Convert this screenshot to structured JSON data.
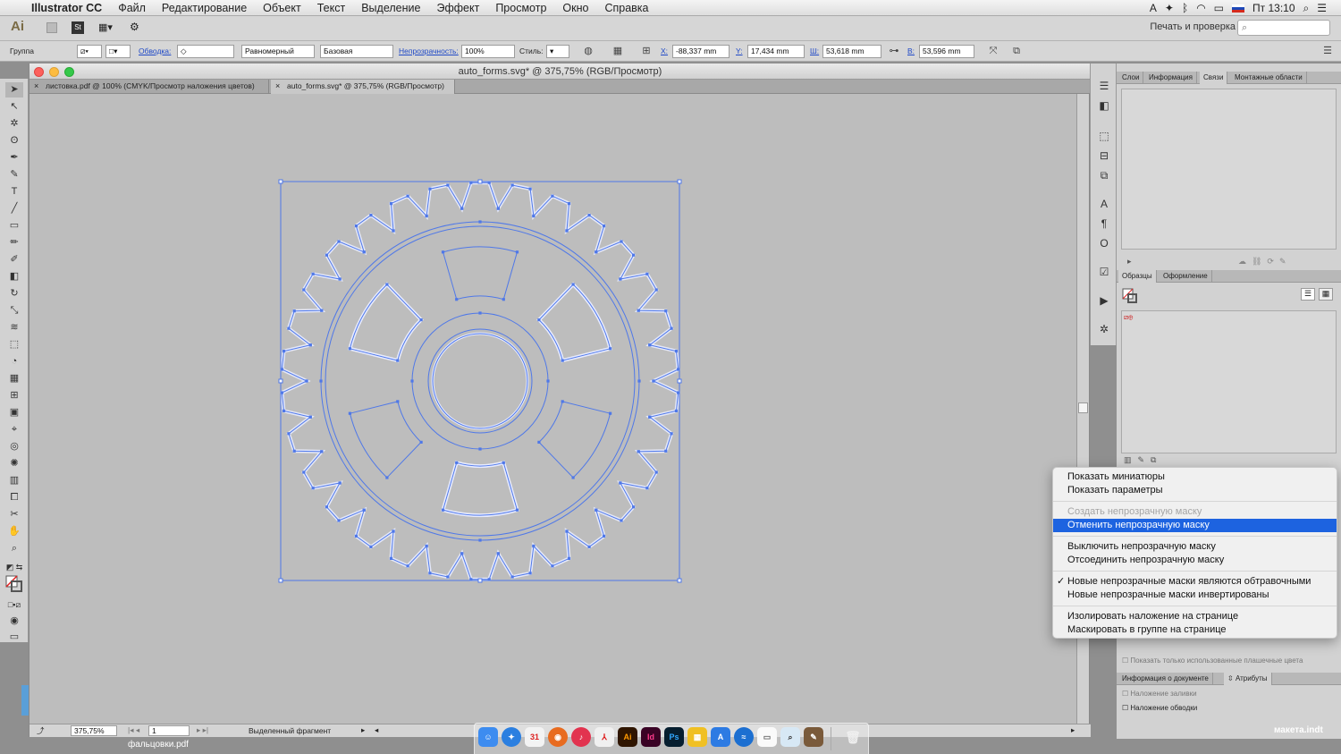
{
  "menubar": {
    "apple": "",
    "app": "Illustrator CC",
    "items": [
      "Файл",
      "Редактирование",
      "Объект",
      "Текст",
      "Выделение",
      "Эффект",
      "Просмотр",
      "Окно",
      "Справка"
    ],
    "clock": "Пт 13:10"
  },
  "appbar": {
    "logo": "Ai",
    "workspace": "Печать и проверка"
  },
  "control": {
    "group_label": "Группа",
    "stroke_label": "Обводка:",
    "stroke_weight": "0",
    "profile": "Равномерный",
    "brush": "Базовая",
    "opacity_label": "Непрозрачность:",
    "opacity": "100%",
    "style_label": "Стиль:",
    "x_label": "X:",
    "x": "-88,337 mm",
    "y_label": "Y:",
    "y": "17,434 mm",
    "w_label": "Ш:",
    "w": "53,618 mm",
    "h_label": "В:",
    "h": "53,596 mm"
  },
  "document": {
    "title": "auto_forms.svg* @ 375,75% (RGB/Просмотр)",
    "tabs": [
      "листовка.pdf @ 100% (CMYK/Просмотр наложения цветов)",
      "auto_forms.svg* @ 375,75% (RGB/Просмотр)"
    ],
    "zoom": "375,75%",
    "page": "1",
    "status": "Выделенный фрагмент"
  },
  "panels": {
    "top_tabs": [
      "Слои",
      "Информация",
      "Связи",
      "Монтажные области"
    ],
    "swatch_tabs": [
      "Образцы",
      "Оформление"
    ],
    "bottom_tabs": [
      "Информация о документе",
      "Атрибуты"
    ],
    "attr_fill": "Наложение заливки",
    "attr_stroke": "Наложение обводки",
    "show_used": "Показать только использованные плашечные цвета"
  },
  "context_menu": [
    {
      "label": "Показать миниатюры",
      "state": "normal"
    },
    {
      "label": "Показать параметры",
      "state": "normal"
    },
    {
      "sep": true
    },
    {
      "label": "Создать непрозрачную маску",
      "state": "disabled"
    },
    {
      "label": "Отменить непрозрачную маску",
      "state": "selected"
    },
    {
      "sep": true
    },
    {
      "label": "Выключить непрозрачную маску",
      "state": "normal"
    },
    {
      "label": "Отсоединить непрозрачную маску",
      "state": "normal"
    },
    {
      "sep": true
    },
    {
      "label": "Новые непрозрачные маски являются обтравочными",
      "state": "checked"
    },
    {
      "label": "Новые непрозрачные маски инвертированы",
      "state": "normal"
    },
    {
      "sep": true
    },
    {
      "label": "Изолировать наложение на странице",
      "state": "normal"
    },
    {
      "label": "Маскировать в группе на странице",
      "state": "normal"
    }
  ],
  "dock": [
    "Ai",
    "Id",
    "Ps"
  ],
  "desktop": {
    "file1": "фальцовки.pdf",
    "file2": "макета.indt"
  },
  "colors": {
    "selection": "#4f78e8",
    "menu_highlight": "#1d63e0",
    "canvas": "#bdbdbd"
  }
}
